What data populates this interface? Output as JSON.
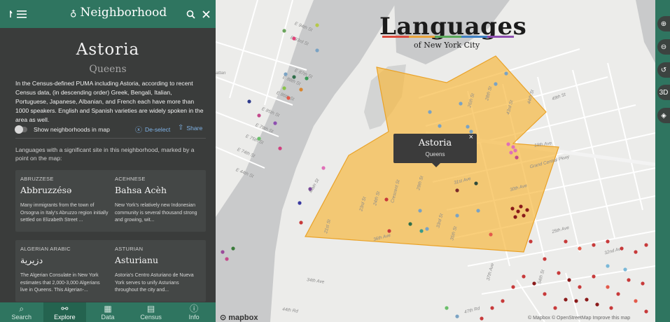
{
  "header": {
    "title": "Neighborhood",
    "nav_icon": "list-indent-icon",
    "search_icon": "search-icon",
    "close_icon": "close-icon",
    "pin_icon": "map-pin-icon"
  },
  "neighborhood": {
    "name": "Astoria",
    "borough": "Queens",
    "description": "In the Census-defined PUMA including Astoria, according to recent Census data, (in descending order) Greek, Bengali, Italian, Portuguese, Japanese, Albanian, and French each have more than 1000 speakers. English and Spanish varieties are widely spoken in the area as well."
  },
  "controls": {
    "toggle_label": "Show neighborhoods in map",
    "deselect_label": "De-select",
    "share_label": "Share"
  },
  "languages_intro": "Languages with a significant site in this neighborhood, marked by a point on the map:",
  "languages": [
    {
      "code": "ABRUZZESE",
      "native": "Abbruzzésə",
      "blurb": "Many immigrants from the town of Orsogna in Italy's Abruzzo region initially settled on Elizabeth Street ..."
    },
    {
      "code": "ACEHNESE",
      "native": "Bahsa Acèh",
      "blurb": "New York's relatively new Indonesian community is several thousand strong and growing, wit..."
    },
    {
      "code": "ALGERIAN ARABIC",
      "native": "دزيرية",
      "blurb": "The Algerian Consulate in New York estimates that 2,000-3,000 Algerians live in Queens. This Algerian-..."
    },
    {
      "code": "ASTURIAN",
      "native": "Asturianu",
      "blurb": "Astoria's Centro Asturiano de Nueva York serves to unify Asturians throughout the city and..."
    }
  ],
  "bottom_nav": [
    {
      "label": "Search",
      "icon": "search-icon"
    },
    {
      "label": "Explore",
      "icon": "binoculars-icon",
      "active": true
    },
    {
      "label": "Data",
      "icon": "table-icon"
    },
    {
      "label": "Census",
      "icon": "clipboard-icon"
    },
    {
      "label": "Info",
      "icon": "info-icon"
    }
  ],
  "map": {
    "title": "Languages",
    "subtitle": "of New York City",
    "popup": {
      "name": "Astoria",
      "borough": "Queens"
    },
    "logo": "mapbox",
    "attribution": "© Mapbox © OpenStreetMap Improve this map",
    "highlight_color": "#f7b941",
    "street_labels": [
      "attan",
      "E 94th St",
      "E 93rd St",
      "E 87th St",
      "E 88th St",
      "E 86th St",
      "E 85th St",
      "E 79th St",
      "E 77th St",
      "E 76th St",
      "E 75th St",
      "E 74th St",
      "E 71st St",
      "E 72nd St",
      "E 48th St",
      "E 44th St",
      "Main St",
      "23rd St",
      "24th St",
      "Crescent St",
      "29th St",
      "31st Ave",
      "30th Ave",
      "33rd St",
      "35th St",
      "21st St",
      "36th Ave",
      "43rd St",
      "44th St",
      "45th St",
      "48th St",
      "49th St",
      "19th Ave",
      "Grand Central Pkwy",
      "25th Ave",
      "32nd Ave",
      "34th Ave",
      "44th Rd",
      "47th Rd",
      "37th Ave",
      "53rd St",
      "54th St",
      "57th St",
      "64th St",
      "69th St",
      "70th St",
      "82nd St",
      "81st St",
      "77th St",
      "67th St",
      "26th St",
      "28th St"
    ]
  },
  "map_controls": [
    {
      "icon": "zoom-in-icon"
    },
    {
      "icon": "zoom-out-icon"
    },
    {
      "icon": "reset-rotation-icon"
    },
    {
      "label": "3D",
      "icon": "3d-view-icon"
    },
    {
      "icon": "layers-icon"
    }
  ],
  "colors": {
    "brand": "#2f7560",
    "panel": "#3a3c3b",
    "link": "#7fb2e6"
  }
}
